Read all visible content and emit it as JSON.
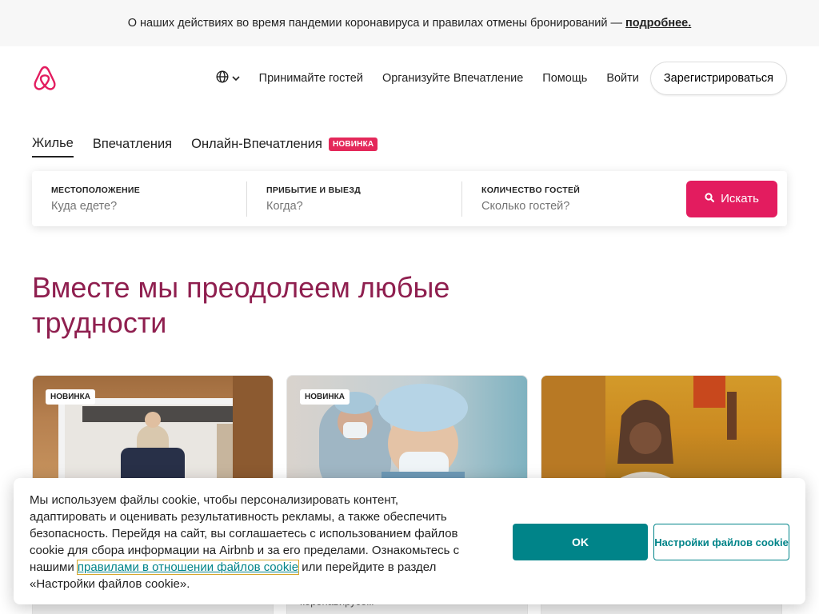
{
  "banner": {
    "text": "О наших действиях во время пандемии коронавируса и правилах отмены бронирований —",
    "link": "подробнее."
  },
  "header": {
    "logo_icon": "airbnb-logo-icon",
    "lang_icon": "globe-icon",
    "nav": [
      "Принимайте гостей",
      "Организуйте Впечатление",
      "Помощь",
      "Войти"
    ],
    "signup": "Зарегистрироваться"
  },
  "tabs": [
    {
      "label": "Жилье",
      "active": true
    },
    {
      "label": "Впечатления",
      "active": false
    },
    {
      "label": "Онлайн-Впечатления",
      "active": false,
      "badge": "новинка"
    }
  ],
  "search": {
    "location_label": "Местоположение",
    "location_placeholder": "Куда едете?",
    "dates_label": "Прибытие и выезд",
    "dates_placeholder": "Когда?",
    "guests_label": "Количество гостей",
    "guests_placeholder": "Сколько гостей?",
    "button": "Искать"
  },
  "hero": {
    "title": "Вместе мы преодолеем любые трудности"
  },
  "cards": [
    {
      "badge": "новинка",
      "footer": ""
    },
    {
      "badge": "новинка",
      "footer": "коронавирусом"
    },
    {
      "badge": "",
      "footer": ""
    }
  ],
  "cookie": {
    "text_before": "Мы используем файлы cookie, чтобы персонализировать контент, адаптировать и оценивать результативность рекламы, а также обеспечить безопасность. Перейдя на сайт, вы соглашаетесь с использованием файлов cookie для сбора информации на Airbnb и за его пределами. Ознакомьтесь с нашими",
    "link": "правилами в отношении файлов cookie",
    "text_after": "или перейдите в раздел «Настройки файлов cookie».",
    "ok": "OK",
    "settings": "Настройки файлов cookie"
  },
  "colors": {
    "brand": "#e31c5f",
    "hero_title": "#8f1f4f",
    "cookie_accent": "#008489"
  }
}
